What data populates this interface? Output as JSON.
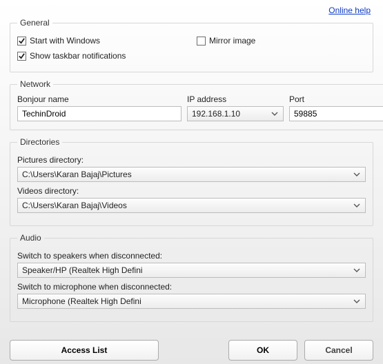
{
  "help_link": "Online help",
  "general": {
    "legend": "General",
    "start_with_windows": {
      "label": "Start with Windows",
      "checked": true
    },
    "mirror_image": {
      "label": "Mirror image",
      "checked": false
    },
    "show_taskbar": {
      "label": "Show taskbar notifications",
      "checked": true
    }
  },
  "network": {
    "legend": "Network",
    "bonjour_label": "Bonjour name",
    "bonjour_value": "TechinDroid",
    "ip_label": "IP address",
    "ip_value": "192.168.1.10",
    "port_label": "Port",
    "port_value": "59885"
  },
  "directories": {
    "legend": "Directories",
    "pictures_label": "Pictures directory:",
    "pictures_value": "C:\\Users\\Karan Bajaj\\Pictures",
    "videos_label": "Videos directory:",
    "videos_value": "C:\\Users\\Karan Bajaj\\Videos"
  },
  "audio": {
    "legend": "Audio",
    "speakers_label": "Switch to speakers when disconnected:",
    "speakers_value": "Speaker/HP (Realtek High Defini",
    "mic_label": "Switch to microphone when disconnected:",
    "mic_value": "Microphone (Realtek High Defini"
  },
  "buttons": {
    "access": "Access List",
    "ok": "OK",
    "cancel": "Cancel"
  }
}
